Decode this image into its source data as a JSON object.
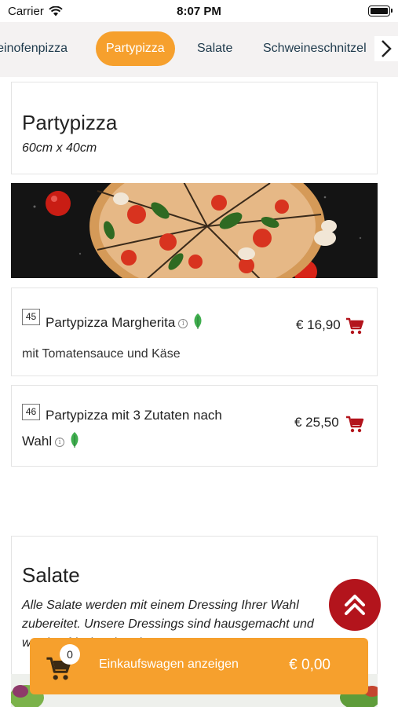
{
  "status_bar": {
    "carrier": "Carrier",
    "time": "8:07 PM"
  },
  "tabs": [
    {
      "label": "Steinofenpizza",
      "active": false
    },
    {
      "label": "Partypizza",
      "active": true
    },
    {
      "label": "Salate",
      "active": false
    },
    {
      "label": "Schweineschnitzel",
      "active": false
    }
  ],
  "partypizza": {
    "title": "Partypizza",
    "subtitle": "60cm x 40cm",
    "items": [
      {
        "number": "45",
        "name": "Partypizza Margherita",
        "description": "mit Tomatensauce und Käse",
        "price": "€ 16,90"
      },
      {
        "number": "46",
        "name_line1": "Partypizza mit 3 Zutaten nach",
        "name_line2": "Wahl",
        "price": "€ 25,50"
      }
    ]
  },
  "salate": {
    "title": "Salate",
    "description": "Alle Salate werden mit einem Dressing Ihrer Wahl zubereitet. Unsere Dressings sind hausgemacht und werden frisch zubereitet."
  },
  "cart": {
    "count": "0",
    "label": "Einkaufswagen anzeigen",
    "total": "€ 0,00"
  },
  "colors": {
    "accent": "#f6a02d",
    "cart_red": "#b3141c",
    "veg_green": "#3fae4e",
    "nav_text": "#1e3a4c"
  }
}
